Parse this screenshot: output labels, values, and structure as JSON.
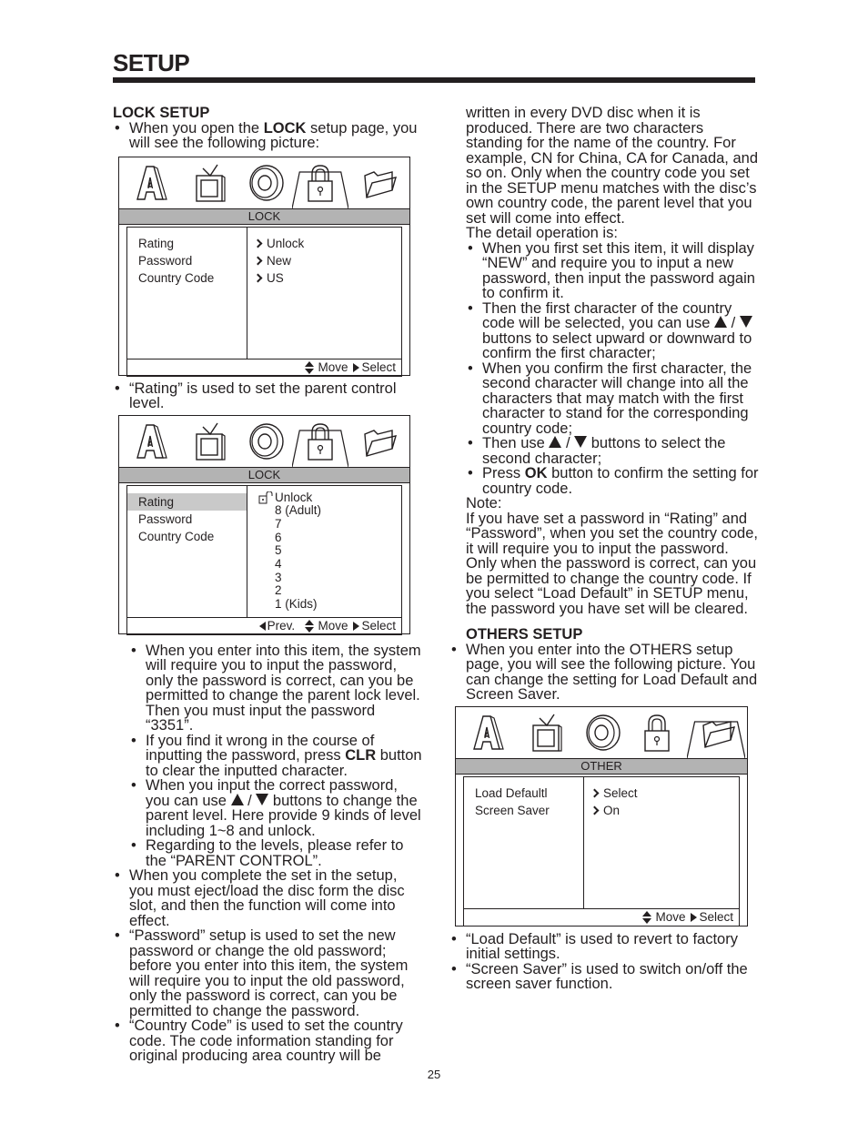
{
  "page": {
    "title": "SETUP",
    "page_number": "25"
  },
  "lock_setup": {
    "heading": "LOCK SETUP",
    "intro_bullet": {
      "pre": "When you open the ",
      "bold": "LOCK",
      "post": " setup page, you will see the following picture:"
    },
    "screen1": {
      "icons": [
        "language-icon",
        "tv-icon",
        "disc-icon",
        "lock-icon",
        "folder-icon"
      ],
      "active_tab": "lock-icon",
      "bar_label": "LOCK",
      "menu_items": [
        "Rating",
        "Password",
        "Country Code"
      ],
      "values": [
        "Unlock",
        "New",
        "US"
      ],
      "footer": {
        "move": "Move",
        "select": "Select"
      }
    },
    "rating_bullet": "“Rating” is used to set the parent control level.",
    "screen2": {
      "bar_label": "LOCK",
      "menu_items": [
        "Rating",
        "Password",
        "Country Code"
      ],
      "selected_item": "Rating",
      "levels": [
        "Unlock",
        "8 (Adult)",
        "7",
        "6",
        "5",
        "4",
        "3",
        "2",
        "1 (Kids)"
      ],
      "footer": {
        "prev": "Prev.",
        "move": "Move",
        "select": "Select"
      }
    },
    "rating_subbullets": [
      "When you enter into this item, the system will require you to input the password, only the password is correct, can you be permitted to change the parent lock level. Then you must input the password “3351”.",
      {
        "pre": "If you find it wrong in the course of inputting the password, press ",
        "bold": "CLR",
        "post": " button to clear the inputted character."
      },
      {
        "pre": "When you input the correct password, you can use ",
        "post": " buttons to change the parent level. Here provide 9 kinds of level including 1~8 and unlock."
      },
      "Regarding to the levels, please refer to the “PARENT CONTROL”."
    ],
    "bullets": [
      "When you complete the set in the setup, you must eject/load the disc form the disc slot, and then the function will come into effect.",
      "“Password” setup is used to set the new password or change the old password; before you enter into this item, the system will require you to input the old password, only the password is correct, can you be permitted to change the password.",
      "“Country Code” is used to set the country code. The code information standing for original producing area country will be"
    ]
  },
  "right_column": {
    "continuation": "written in every DVD disc when it is produced. There are two characters standing for the name of the country. For example, CN for China, CA for Canada, and so on. Only when the country code you set in the SETUP menu matches with the disc’s own country code, the parent level that you set will come into effect.",
    "detail_intro": "The detail operation is:",
    "detail_bullets": [
      "When you first set this item, it will display “NEW” and require you to input a new password, then input the password again to confirm it.",
      {
        "pre": "Then the first character of the country code will be selected, you can use ",
        "post": " buttons to select upward or downward to confirm the first character;"
      },
      "When you confirm the first character, the second character will change into all the characters that may match with the first character to stand for the corresponding country code;",
      {
        "pre": "Then use ",
        "post": " buttons to select the second character;"
      },
      {
        "pre": "Press ",
        "bold": "OK",
        "post": " button to confirm the setting for country code."
      }
    ],
    "note_label": "Note:",
    "note_text": "If you have set a password in “Rating” and “Password”, when you set the country code, it will require you to input the password. Only when the password is correct, can you be permitted to change the country code.  If you select “Load Default” in SETUP menu, the password you have set will be cleared."
  },
  "others_setup": {
    "heading": "OTHERS SETUP",
    "intro_bullet": "When you enter into the OTHERS setup page, you will see the following picture. You can change the setting for Load Default and Screen Saver.",
    "screen": {
      "active_tab": "folder-icon",
      "bar_label": "OTHER",
      "menu_items": [
        "Load Defaultl",
        "Screen Saver"
      ],
      "values": [
        "Select",
        "On"
      ],
      "footer": {
        "move": "Move",
        "select": "Select"
      }
    },
    "bullets": [
      "“Load Default” is used to revert to factory initial settings.",
      "“Screen Saver” is used to switch on/off the screen saver function."
    ]
  }
}
